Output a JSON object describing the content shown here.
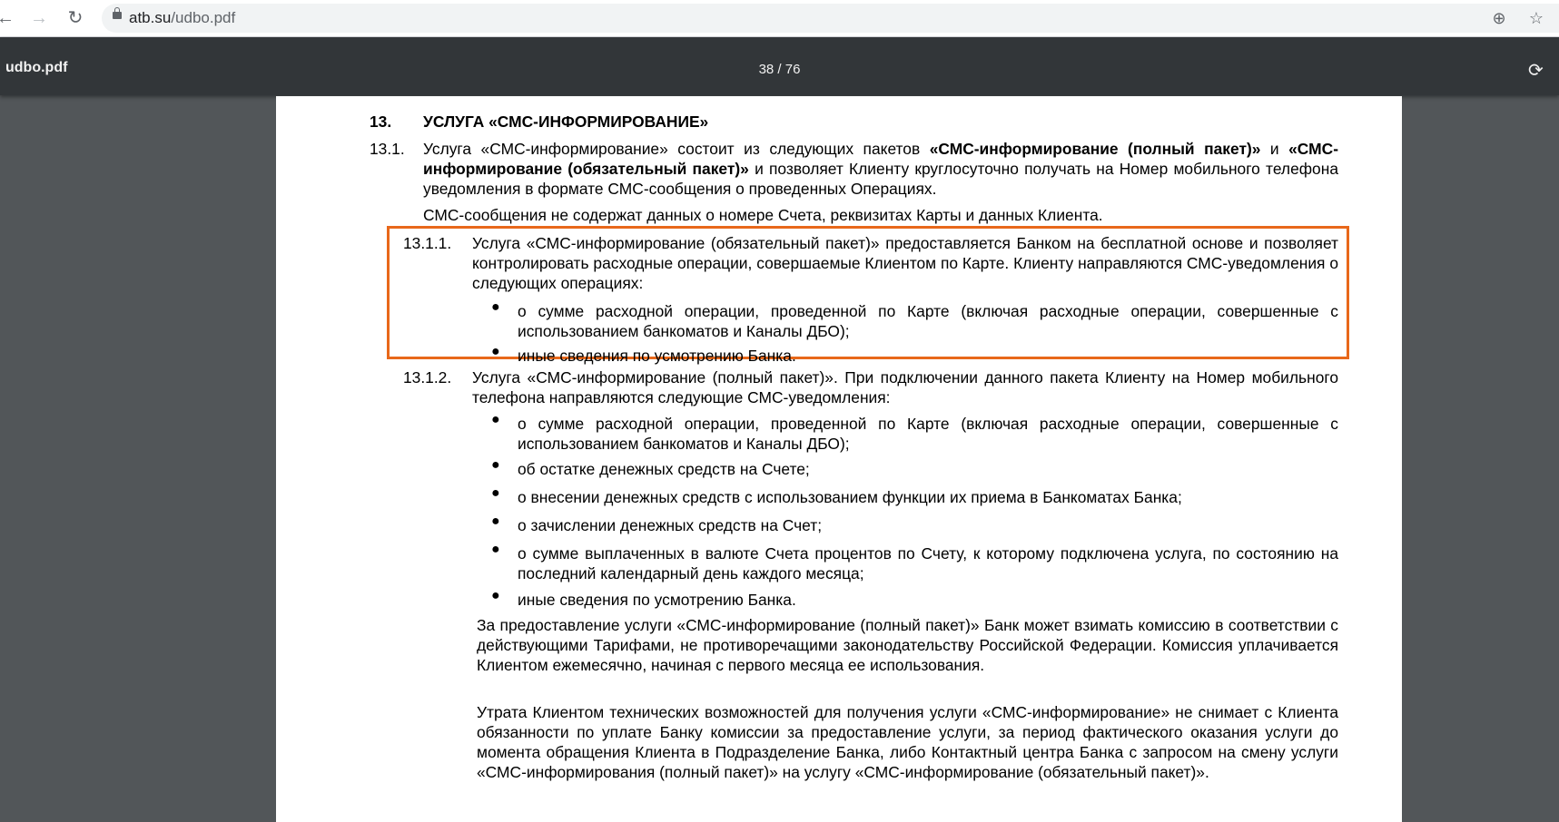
{
  "browser": {
    "url_host": "atb.su",
    "url_path": "/udbo.pdf"
  },
  "pdf": {
    "filename": "udbo.pdf",
    "page_indicator": "38 / 76"
  },
  "doc": {
    "section_number": "13.",
    "section_title": "УСЛУГА «СМС-ИНФОРМИРОВАНИЕ»",
    "p131_num": "13.1.",
    "p131_a": "Услуга «СМС-информирование» состоит из следующих пакетов",
    "p131_b1": "«СМС-информирование (полный пакет)»",
    "p131_c": "и",
    "p131_b2": "«СМС-информирование (обязательный пакет)»",
    "p131_d": "и позволяет Клиенту круглосуточно получать на Номер мобильного телефона уведомления в формате СМС-сообщения о проведенных Операциях.",
    "p131_2": "СМС-сообщения не содержат данных о номере Счета, реквизитах Карты и данных Клиента.",
    "p1311_num": "13.1.1.",
    "p1311_text": "Услуга «СМС-информирование (обязательный пакет)» предоставляется Банком на бесплатной основе и позволяет контролировать расходные операции, совершаемые Клиентом по Карте. Клиенту направляются СМС-уведомления о следующих операциях:",
    "p1311_items": [
      "о сумме расходной операции, проведенной по Карте (включая расходные операции, совершенные с использованием банкоматов и Каналы ДБО);",
      "иные сведения по усмотрению Банка."
    ],
    "p1312_num": "13.1.2.",
    "p1312_text": "Услуга «СМС-информирование (полный пакет)». При подключении данного пакета Клиенту на Номер мобильного телефона направляются следующие СМС-уведомления:",
    "p1312_items": [
      "о сумме расходной операции, проведенной по Карте (включая расходные операции, совершенные с использованием банкоматов и Каналы ДБО);",
      "об остатке денежных средств на Счете;",
      "о внесении денежных средств с использованием функции их приема в Банкоматах Банка;",
      "о зачислении денежных средств на Счет;",
      "о сумме выплаченных в валюте Счета процентов по Счету, к которому подключена услуга, по состоянию на последний календарный день каждого месяца;",
      "иные сведения по усмотрению Банка."
    ],
    "p_commission": "За предоставление услуги «СМС-информирование (полный пакет)» Банк может взимать комиссию в соответствии с действующими Тарифами, не противоречащими законодательству Российской Федерации. Комиссия уплачивается Клиентом ежемесячно, начиная с первого месяца ее использования.",
    "p_loss": "Утрата Клиентом технических возможностей для получения услуги «СМС-информирование» не снимает с Клиента обязанности по уплате Банку комиссии за предоставление услуги, за период фактического оказания услуги до момента обращения Клиента в Подразделение Банка, либо Контактный центра Банка с запросом на смену услуги «СМС-информирования (полный пакет)» на услугу «СМС-информирование (обязательный пакет)»."
  },
  "colors": {
    "highlight": "#e8681a",
    "pdf_toolbar": "#323639",
    "viewer_bg": "#525659"
  },
  "icons": [
    "back-icon",
    "forward-icon",
    "reload-icon",
    "lock-icon",
    "zoom-icon",
    "star-icon",
    "rotate-icon"
  ]
}
